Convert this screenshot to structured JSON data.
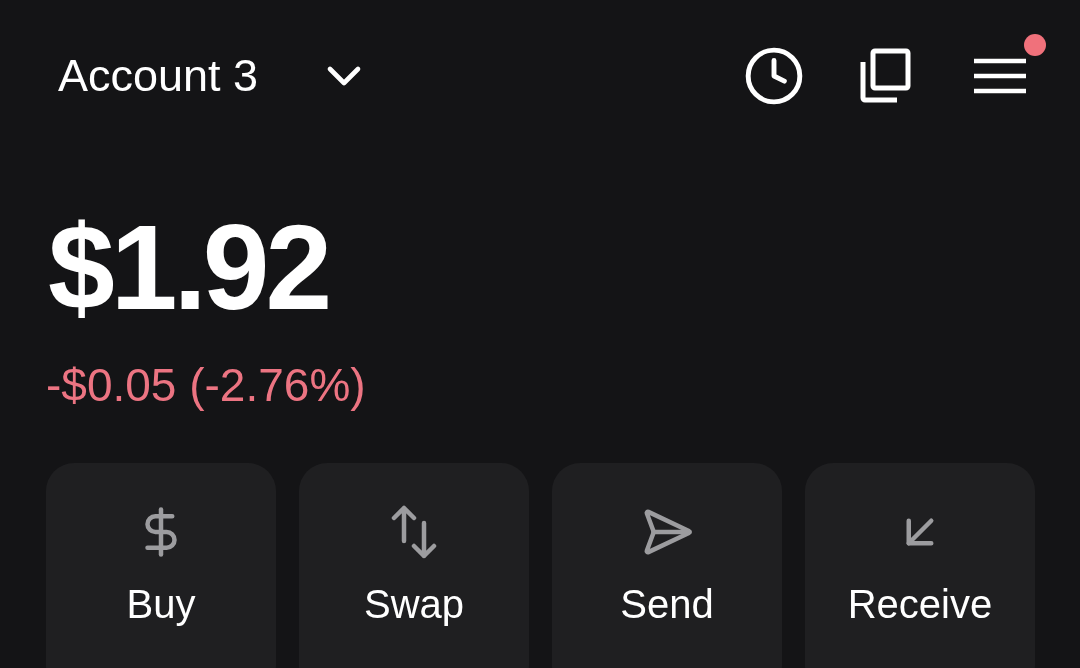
{
  "header": {
    "account_name": "Account 3",
    "notification_dot": true
  },
  "balance": {
    "amount": "$1.92",
    "change": "-$0.05 (-2.76%)",
    "negative": true
  },
  "actions": [
    {
      "kind": "buy",
      "label": "Buy"
    },
    {
      "kind": "swap",
      "label": "Swap"
    },
    {
      "kind": "send",
      "label": "Send"
    },
    {
      "kind": "receive",
      "label": "Receive"
    }
  ]
}
